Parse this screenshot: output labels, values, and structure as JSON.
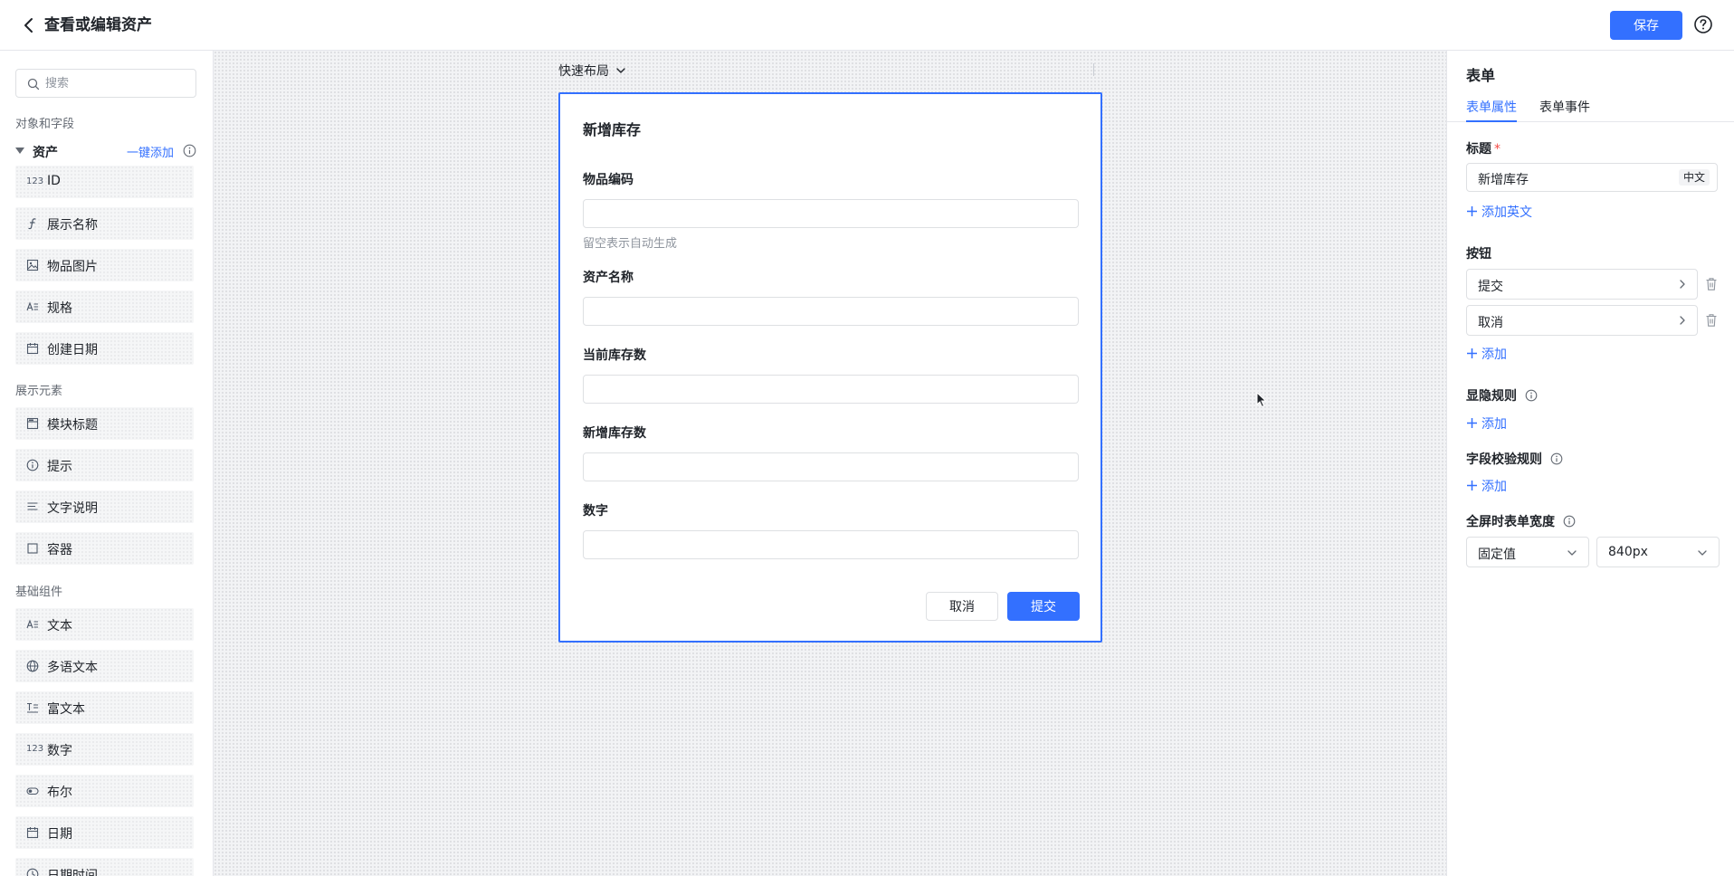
{
  "header": {
    "title": "查看或编辑资产",
    "save_label": "保存"
  },
  "sidebar": {
    "search_placeholder": "搜索",
    "section_objects": "对象和字段",
    "asset_group": {
      "label": "资产",
      "add_all": "一键添加"
    },
    "fields": [
      {
        "icon": "number-icon",
        "icon_text": "123",
        "label": "ID"
      },
      {
        "icon": "formula-icon",
        "label": "展示名称"
      },
      {
        "icon": "image-icon",
        "label": "物品图片"
      },
      {
        "icon": "text-icon",
        "label": "规格"
      },
      {
        "icon": "calendar-icon",
        "label": "创建日期"
      }
    ],
    "section_display": "展示元素",
    "display_items": [
      {
        "icon": "block-title-icon",
        "label": "模块标题"
      },
      {
        "icon": "info-icon",
        "label": "提示"
      },
      {
        "icon": "paragraph-icon",
        "label": "文字说明"
      },
      {
        "icon": "container-icon",
        "label": "容器"
      }
    ],
    "section_basic": "基础组件",
    "basic_items": [
      {
        "icon": "text-icon",
        "label": "文本"
      },
      {
        "icon": "globe-icon",
        "label": "多语文本"
      },
      {
        "icon": "rich-text-icon",
        "label": "富文本"
      },
      {
        "icon": "number-icon",
        "icon_text": "123",
        "label": "数字"
      },
      {
        "icon": "toggle-icon",
        "label": "布尔"
      },
      {
        "icon": "calendar-icon",
        "label": "日期"
      },
      {
        "icon": "clock-icon",
        "label": "日期时间"
      }
    ]
  },
  "canvas": {
    "quick_layout": "快速布局",
    "form": {
      "title": "新增库存",
      "fields": [
        {
          "label": "物品编码",
          "value": "",
          "hint": "留空表示自动生成"
        },
        {
          "label": "资产名称",
          "value": ""
        },
        {
          "label": "当前库存数",
          "value": ""
        },
        {
          "label": "新增库存数",
          "value": ""
        },
        {
          "label": "数字",
          "value": ""
        }
      ],
      "cancel_label": "取消",
      "submit_label": "提交"
    }
  },
  "right_panel": {
    "title": "表单",
    "tabs": [
      {
        "label": "表单属性",
        "active": true
      },
      {
        "label": "表单事件",
        "active": false
      }
    ],
    "title_label": "标题",
    "title_value": "新增库存",
    "lang_badge": "中文",
    "add_english": "添加英文",
    "buttons_label": "按钮",
    "buttons": [
      "提交",
      "取消"
    ],
    "add_label": "添加",
    "visibility_label": "显隐规则",
    "validation_label": "字段校验规则",
    "fullscreen_width_label": "全屏时表单宽度",
    "width_mode": "固定值",
    "width_value": "840px"
  },
  "colors": {
    "accent": "#3370ff",
    "required": "#f54a45"
  }
}
